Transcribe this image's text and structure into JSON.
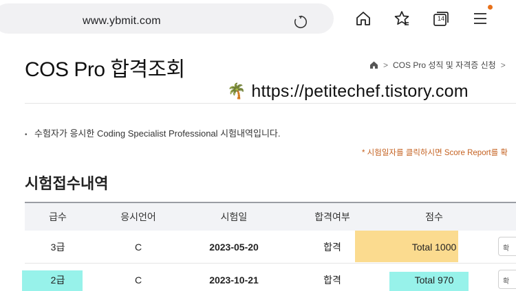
{
  "browser": {
    "url": "www.ybmit.com",
    "tab_count": "14",
    "colors": {
      "notification_dot": "#e8711a",
      "url_bar_bg": "#f1f1f3"
    },
    "icons": [
      "reload-icon",
      "home-icon",
      "favorites-star-icon",
      "tabs-icon",
      "menu-icon"
    ]
  },
  "page": {
    "title": "COS Pro 합격조회",
    "breadcrumb": {
      "home_icon": "home-icon",
      "sep": ">",
      "current": "COS Pro 성직 및 자격증 신청"
    },
    "watermark": {
      "emoji": "🌴",
      "text": "https://petitechef.tistory.com"
    },
    "info_bullet": "•",
    "info_text": "수험자가 응시한 Coding Specialist Professional 시험내역입니다.",
    "note": "* 시험일자를 클릭하시면 Score Report를 확",
    "section_title": "시험접수내역",
    "colors": {
      "note": "#c4601f",
      "highlight_amber": "#fbdb8f",
      "highlight_cyan": "#97f2ea",
      "header_bg": "#f2f3f6"
    }
  },
  "table": {
    "headers": [
      "급수",
      "응시언어",
      "시험일",
      "합격여부",
      "점수"
    ],
    "rows": [
      {
        "grade": "3급",
        "language": "C",
        "date": "2023-05-20",
        "result": "합격",
        "score": "Total 1000",
        "button": "확"
      },
      {
        "grade": "2급",
        "language": "C",
        "date": "2023-10-21",
        "result": "합격",
        "score": "Total 970",
        "button": "확"
      }
    ]
  }
}
